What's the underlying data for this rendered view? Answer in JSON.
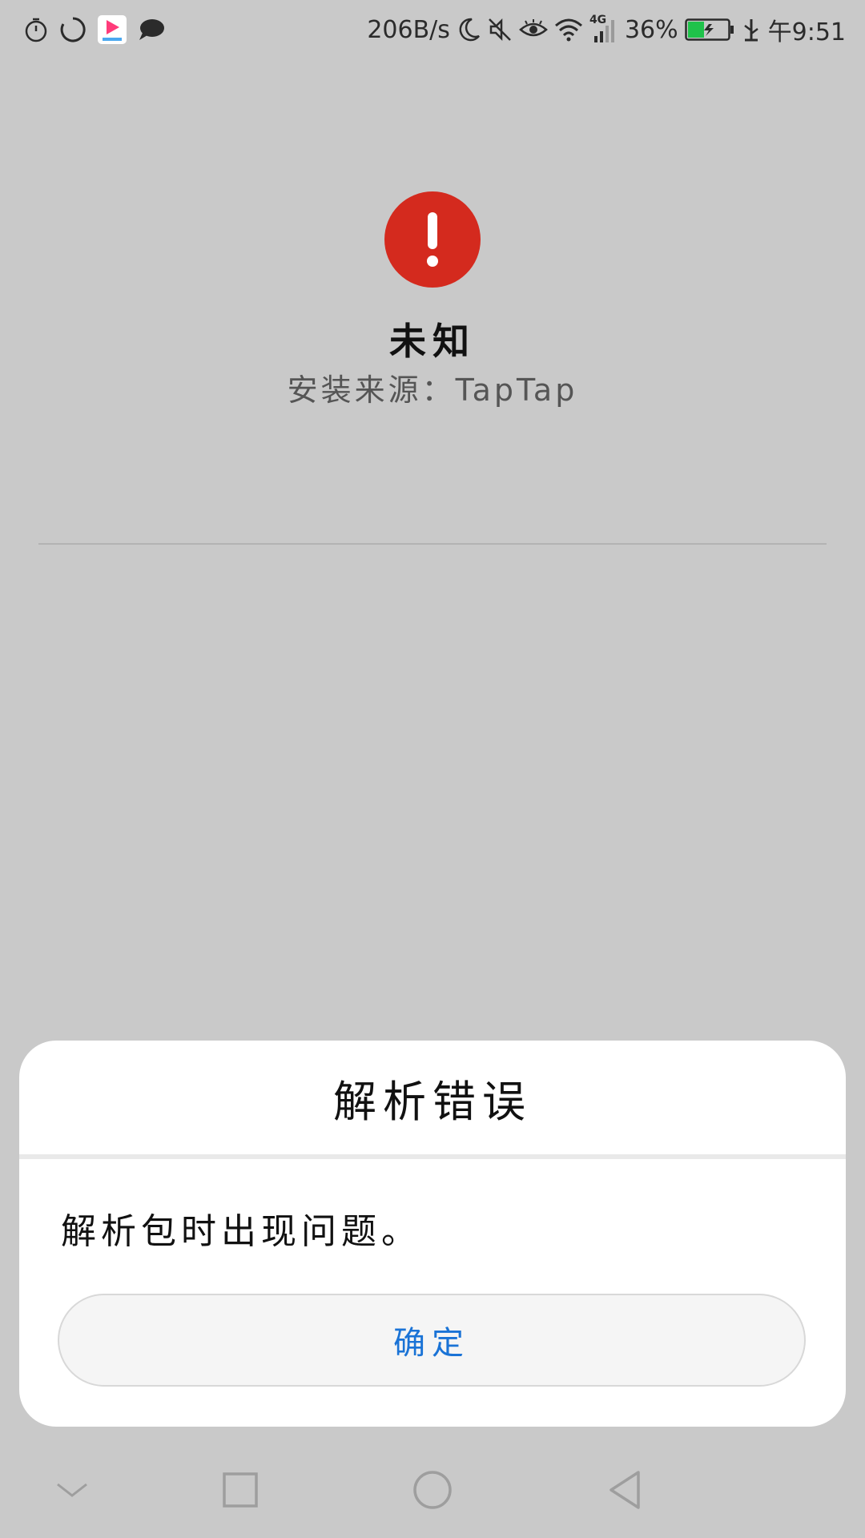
{
  "status_bar": {
    "net_speed": "206B/s",
    "network_type": "4G",
    "battery_percent": "36%",
    "time": "午9:51",
    "left_icons": [
      "timer-icon",
      "loading-icon",
      "youku-icon",
      "chat-icon"
    ],
    "right_icons": [
      "moon-icon",
      "mute-icon",
      "eye-icon",
      "wifi-icon",
      "signal-icon",
      "battery-icon",
      "usb-icon"
    ]
  },
  "app": {
    "name": "未知",
    "install_source": "安装来源：TapTap",
    "icon": "alert-icon",
    "icon_color": "#d42a1e"
  },
  "dialog": {
    "title": "解析错误",
    "message": "解析包时出现问题。",
    "confirm_label": "确定",
    "confirm_color": "#1a73d6"
  },
  "nav_bar": {
    "buttons": [
      "collapse-icon",
      "recents-icon",
      "home-icon",
      "back-icon"
    ]
  }
}
